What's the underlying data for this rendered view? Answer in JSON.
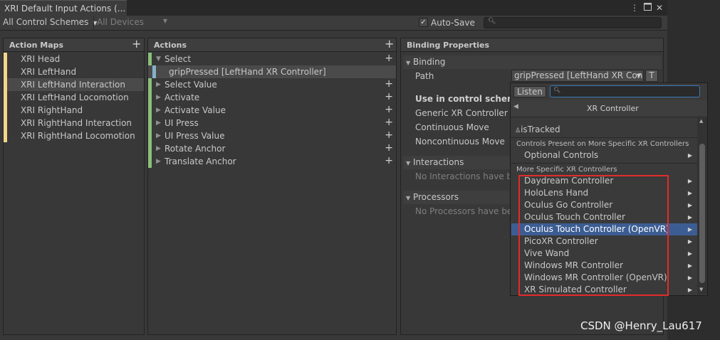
{
  "window": {
    "tab_title": "XRI Default Input Actions (...",
    "menu_icon": "kebab-menu-icon",
    "maximize_icon": "maximize-icon",
    "close_icon": "close-icon"
  },
  "toolbar": {
    "control_schemes": "All Control Schemes",
    "devices": "All Devices",
    "auto_save_label": "Auto-Save",
    "auto_save_checked": true,
    "search_value": ""
  },
  "action_maps": {
    "header": "Action Maps",
    "items": [
      {
        "label": "XRI Head",
        "selected": false
      },
      {
        "label": "XRI LeftHand",
        "selected": false
      },
      {
        "label": "XRI LeftHand Interaction",
        "selected": true
      },
      {
        "label": "XRI LeftHand Locomotion",
        "selected": false
      },
      {
        "label": "XRI RightHand",
        "selected": false
      },
      {
        "label": "XRI RightHand Interaction",
        "selected": false
      },
      {
        "label": "XRI RightHand Locomotion",
        "selected": false
      }
    ]
  },
  "actions": {
    "header": "Actions",
    "items": [
      {
        "label": "Select",
        "expanded": true
      },
      {
        "label": "Select Value",
        "expanded": false
      },
      {
        "label": "Activate",
        "expanded": false
      },
      {
        "label": "Activate Value",
        "expanded": false
      },
      {
        "label": "UI Press",
        "expanded": false
      },
      {
        "label": "UI Press Value",
        "expanded": false
      },
      {
        "label": "Rotate Anchor",
        "expanded": false
      },
      {
        "label": "Translate Anchor",
        "expanded": false
      }
    ],
    "binding": "gripPressed [LeftHand XR Controller]"
  },
  "properties": {
    "header": "Binding Properties",
    "binding_section": "Binding",
    "path_label": "Path",
    "path_value": "gripPressed [LeftHand XR Con",
    "t_button": "T",
    "use_in_scheme": "Use in control scheme",
    "schemes": [
      "Generic XR Controller",
      "Continuous Move",
      "Noncontinuous Move"
    ],
    "interactions_section": "Interactions",
    "no_interactions": "No Interactions have bee",
    "processors_section": "Processors",
    "no_processors": "No Processors have bee"
  },
  "popup": {
    "listen_label": "Listen",
    "search_value": "",
    "title": "XR Controller",
    "is_tracked": "isTracked",
    "specific_header": "Controls Present on More Specific XR Controllers",
    "optional_controls": "Optional Controls",
    "more_specific_header": "More Specific XR Controllers",
    "controllers": [
      {
        "label": "Daydream Controller",
        "selected": false
      },
      {
        "label": "HoloLens Hand",
        "selected": false
      },
      {
        "label": "Oculus Go Controller",
        "selected": false
      },
      {
        "label": "Oculus Touch Controller",
        "selected": false
      },
      {
        "label": "Oculus Touch Controller (OpenVR)",
        "selected": true
      },
      {
        "label": "PicoXR Controller",
        "selected": false
      },
      {
        "label": "Vive Wand",
        "selected": false
      },
      {
        "label": "Windows MR Controller",
        "selected": false
      },
      {
        "label": "Windows MR Controller (OpenVR)",
        "selected": false
      },
      {
        "label": "XR Simulated Controller",
        "selected": false
      }
    ]
  },
  "watermark": "CSDN @Henry_Lau617",
  "colors": {
    "accent_selected": "#3c5d93",
    "highlight_box": "#e22b2b",
    "action_map_bar": "#f4d58a",
    "action_bar": "#8dc07b",
    "binding_bar": "#87b0c8"
  }
}
